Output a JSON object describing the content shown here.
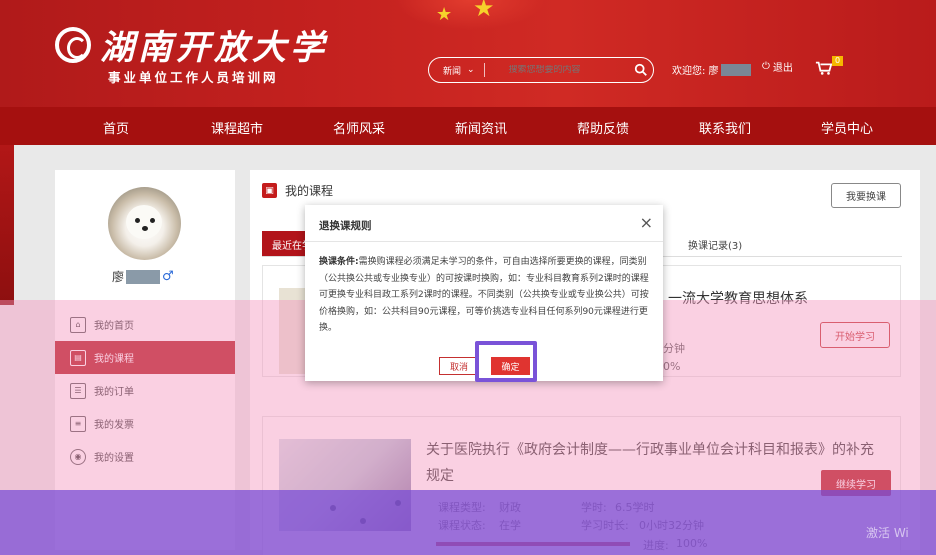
{
  "header": {
    "title": "湖南开放大学",
    "subtitle": "事业单位工作人员培训网",
    "search_category": "新闻",
    "search_placeholder": "搜索您想要的内容",
    "welcome": "欢迎您: 廖",
    "logout": "退出",
    "cart_count": "0"
  },
  "nav": {
    "items": [
      "首页",
      "课程超市",
      "名师风采",
      "新闻资讯",
      "帮助反馈",
      "联系我们",
      "学员中心"
    ]
  },
  "sidebar": {
    "username": "廖",
    "menu": [
      "我的首页",
      "我的课程",
      "我的订单",
      "我的发票",
      "我的设置"
    ]
  },
  "main": {
    "heading": "我的课程",
    "switch_button": "我要换课",
    "tab_recent": "最近在学",
    "tab_record": "换课记录(3)",
    "course1_title": "一流大学教育思想体系",
    "course1_action": "开始学习",
    "course1_minutes": "分钟",
    "course1_progress": "0%",
    "course2_title": "关于医院执行《政府会计制度——行政事业单位会计科目和报表》的补充规定",
    "course2_action": "继续学习",
    "course2_type_label": "课程类型:",
    "course2_type": "财政",
    "course2_hours_label": "学时:",
    "course2_hours": "6.5学时",
    "course2_status_label": "课程状态:",
    "course2_status": "在学",
    "course2_time_label": "学习时长:",
    "course2_time": "0小时32分钟",
    "course2_progress_label": "进度:",
    "course2_progress": "100%"
  },
  "modal": {
    "title": "退换课规则",
    "body_label": "换课条件:",
    "body_text": "需换购课程必须满足未学习的条件，可自由选择所要更换的课程，同类别（公共换公共或专业换专业）的可按课时换购，如：专业科目教育系列2课时的课程可更换专业科目政工系列2课时的课程。不同类别（公共换专业或专业换公共）可按价格换购，如：公共科目90元课程，可等价挑选专业科目任何系列90元课程进行更换。",
    "cancel": "取消",
    "confirm": "确定"
  },
  "watermark": "激活 Wi",
  "colors": {
    "brand_red": "#b2141a",
    "nav_red": "#a5100f",
    "highlight": "#7a53d8",
    "overlay_pink": "#f496be",
    "overlay_purple": "#8a56d2"
  },
  "icons": [
    "search-icon",
    "power-icon",
    "cart-icon",
    "home-icon",
    "course-icon",
    "order-icon",
    "invoice-icon",
    "settings-icon",
    "close-icon",
    "male-icon"
  ]
}
